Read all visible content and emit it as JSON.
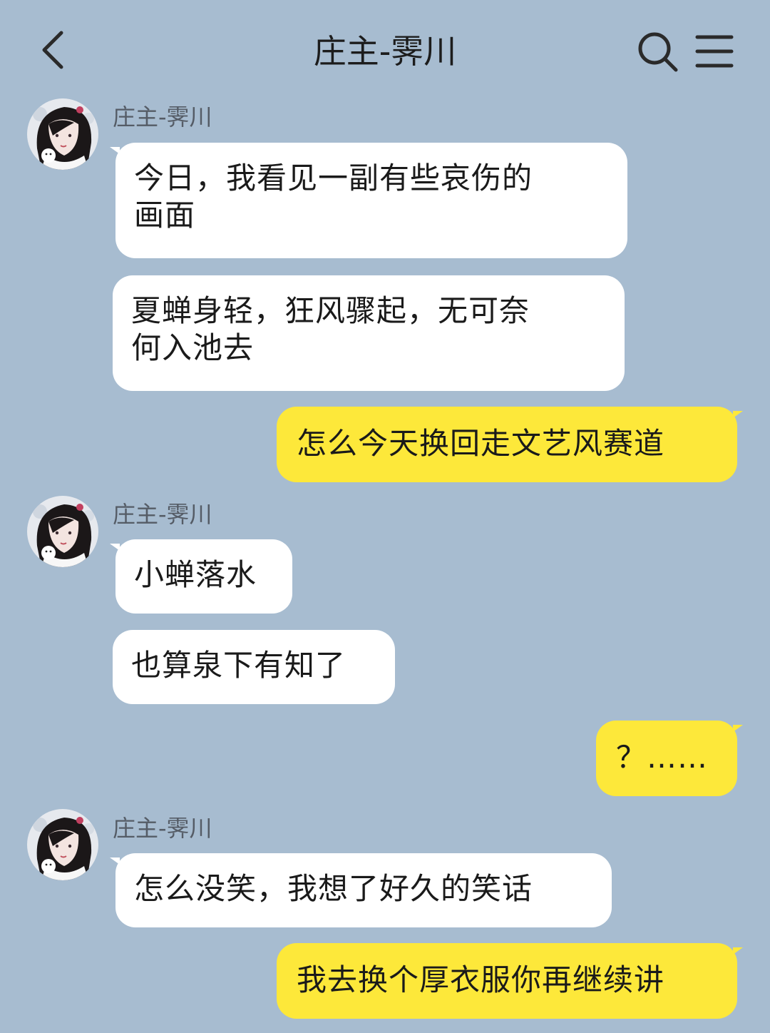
{
  "colors": {
    "background": "#a7bcd0",
    "incoming_bubble": "#ffffff",
    "outgoing_bubble": "#fde83a"
  },
  "header": {
    "title": "庄主-霁川",
    "icons": [
      "back-icon",
      "search-icon",
      "menu-icon"
    ]
  },
  "messages": [
    {
      "side": "in",
      "sender": "庄主-霁川",
      "line1": "今日，我看见一副有些哀伤的",
      "line2": "画面"
    },
    {
      "side": "in",
      "line1": "夏蝉身轻，狂风骤起，无可奈",
      "line2": "何入池去"
    },
    {
      "side": "out",
      "text": "怎么今天换回走文艺风赛道"
    },
    {
      "side": "in",
      "sender": "庄主-霁川",
      "text": "小蝉落水"
    },
    {
      "side": "in",
      "text": "也算泉下有知了"
    },
    {
      "side": "out",
      "text": "？……"
    },
    {
      "side": "in",
      "sender": "庄主-霁川",
      "text": "怎么没笑，我想了好久的笑话"
    },
    {
      "side": "out",
      "text": "我去换个厚衣服你再继续讲"
    }
  ]
}
